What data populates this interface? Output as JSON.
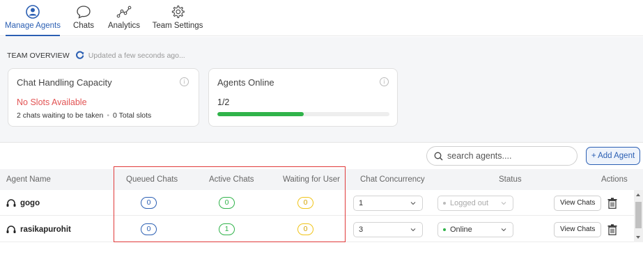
{
  "nav": {
    "tabs": [
      {
        "label": "Manage Agents",
        "icon": "agent-icon",
        "active": true
      },
      {
        "label": "Chats",
        "icon": "chat-bubble-icon",
        "active": false
      },
      {
        "label": "Analytics",
        "icon": "analytics-icon",
        "active": false
      },
      {
        "label": "Team Settings",
        "icon": "gear-icon",
        "active": false
      }
    ]
  },
  "overview": {
    "title": "TEAM OVERVIEW",
    "updated": "Updated a few seconds ago..."
  },
  "capacity_card": {
    "title": "Chat Handling Capacity",
    "status": "No Slots Available",
    "waiting": "2 chats waiting to be taken",
    "slots": "0 Total slots"
  },
  "online_card": {
    "title": "Agents Online",
    "ratio": "1/2",
    "progress": 0.5
  },
  "search": {
    "placeholder": "search agents...."
  },
  "add_button": "+ Add Agent",
  "table": {
    "headers": {
      "agent": "Agent Name",
      "queued": "Queued Chats",
      "active": "Active Chats",
      "waiting": "Waiting for User",
      "concurrency": "Chat Concurrency",
      "status": "Status",
      "actions": "Actions"
    },
    "rows": [
      {
        "name": "gogo",
        "queued": "0",
        "active": "0",
        "waiting": "0",
        "concurrency": "1",
        "status": "Logged out",
        "action": "View Chats"
      },
      {
        "name": "rasikapurohit",
        "queued": "0",
        "active": "1",
        "waiting": "0",
        "concurrency": "3",
        "status": "Online",
        "action": "View Chats"
      }
    ]
  },
  "colors": {
    "accent": "#2b5fb3",
    "danger": "#e25353",
    "online": "#30b34a",
    "waiting": "#f0c419"
  }
}
